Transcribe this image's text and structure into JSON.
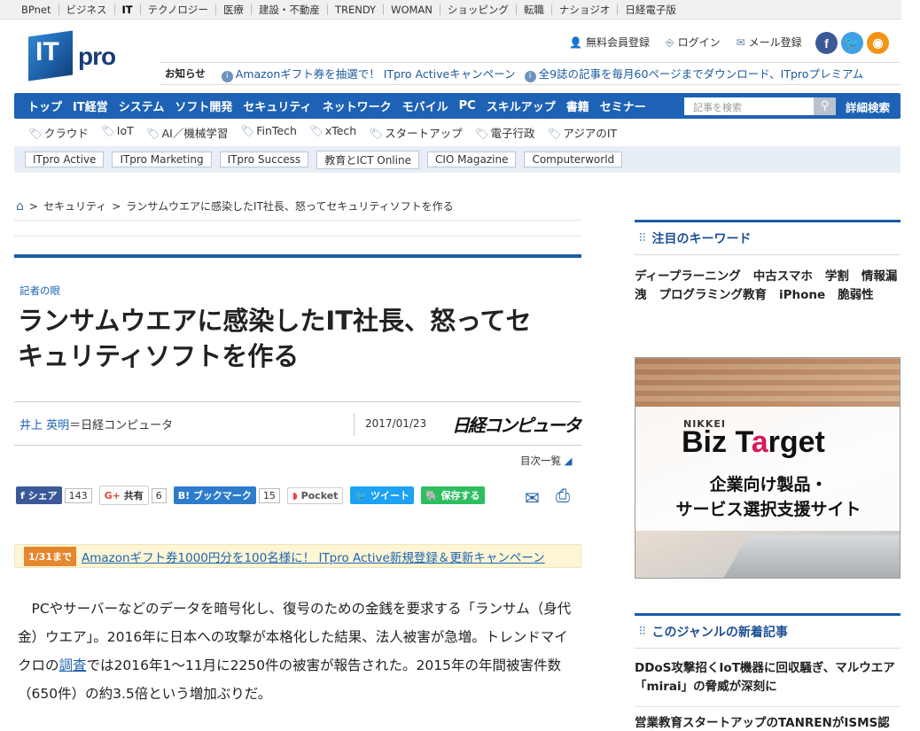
{
  "topbar": [
    "BPnet",
    "ビジネス",
    "IT",
    "テクノロジー",
    "医療",
    "建設・不動産",
    "TRENDY",
    "WOMAN",
    "ショッピング",
    "転職",
    "ナショジオ",
    "日経電子版"
  ],
  "logo": {
    "it": "IT",
    "pro": "pro"
  },
  "user_links": {
    "signup": "無料会員登録",
    "login": "ログイン",
    "mail": "メール登録"
  },
  "social": {
    "facebook": "f",
    "twitter": "t",
    "rss": "r"
  },
  "notice": {
    "label": "お知らせ",
    "items": [
      "Amazonギフト券を抽選で！ ITpro Activeキャンペーン",
      "全9誌の記事を毎月60ページまでダウンロード、ITproプレミアム"
    ]
  },
  "nav": {
    "items": [
      "トップ",
      "IT経営",
      "システム",
      "ソフト開発",
      "セキュリティ",
      "ネットワーク",
      "モバイル",
      "PC",
      "スキルアップ",
      "書籍",
      "セミナー"
    ],
    "search_placeholder": "記事を検索",
    "advanced_search": "詳細検索"
  },
  "tags": [
    "クラウド",
    "IoT",
    "AI／機械学習",
    "FinTech",
    "xTech",
    "スタートアップ",
    "電子行政",
    "アジアのIT"
  ],
  "subsites": [
    "ITpro Active",
    "ITpro Marketing",
    "ITpro Success",
    "教育とICT Online",
    "CIO Magazine",
    "Computerworld"
  ],
  "breadcrumb": {
    "section": "セキュリティ",
    "current": "ランサムウエアに感染したIT社長、怒ってセキュリティソフトを作る"
  },
  "article": {
    "category": "記者の眼",
    "title_line1": "ランサムウエアに感染したIT社長、怒ってセ",
    "title_line2": "キュリティソフトを作る",
    "author": "井上 英明",
    "publication_suffix": "＝日経コンピュータ",
    "date": "2017/01/23",
    "publication_logo": "日経コンピュータ",
    "toc": "目次一覧",
    "body_before_link": "PCやサーバーなどのデータを暗号化し、復号のための金銭を要求する「ランサム（身代金）ウエア」。2016年に日本への攻撃が本格化した結果、法人被害が急増。トレンドマイクロの",
    "body_link": "調査",
    "body_after_link": "では2016年1～11月に2250件の被害が報告された。2015年の年間被害件数（650件）の約3.5倍という増加ぶりだ。"
  },
  "share": {
    "facebook": {
      "label": "シェア",
      "count": "143"
    },
    "gplus": {
      "label": "共有",
      "count": "6"
    },
    "hatena": {
      "label": "ブックマーク",
      "count": "15"
    },
    "pocket": {
      "label": "Pocket"
    },
    "tweet": {
      "label": "ツイート"
    },
    "evernote": {
      "label": "保存する"
    }
  },
  "promo": {
    "badge": "1/31まで",
    "text": "Amazonギフト券1000円分を100名様に！ ITpro Active新規登録＆更新キャンペーン"
  },
  "sidebar": {
    "keywords_title": "注目のキーワード",
    "keywords": [
      "ディープラーニング",
      "中古スマホ",
      "学割",
      "情報漏洩",
      "プログラミング教育",
      "iPhone",
      "脆弱性"
    ],
    "ad": {
      "nikkei": "NIKKEI",
      "brand_a": "Biz T",
      "brand_o": "a",
      "brand_b": "rget",
      "line1": "企業向け製品・",
      "line2": "サービス選択支援サイト"
    },
    "news_title": "このジャンルの新着記事",
    "news": [
      "DDoS攻撃招くIoT機器に回収騒ぎ、マルウエア「mirai」の脅威が深刻に",
      "営業教育スタートアップのTANRENがISMS認"
    ]
  },
  "colors": {
    "nav_blue": "#1d62b4",
    "link_blue": "#1f64b0",
    "promo_orange": "#e6862e"
  }
}
